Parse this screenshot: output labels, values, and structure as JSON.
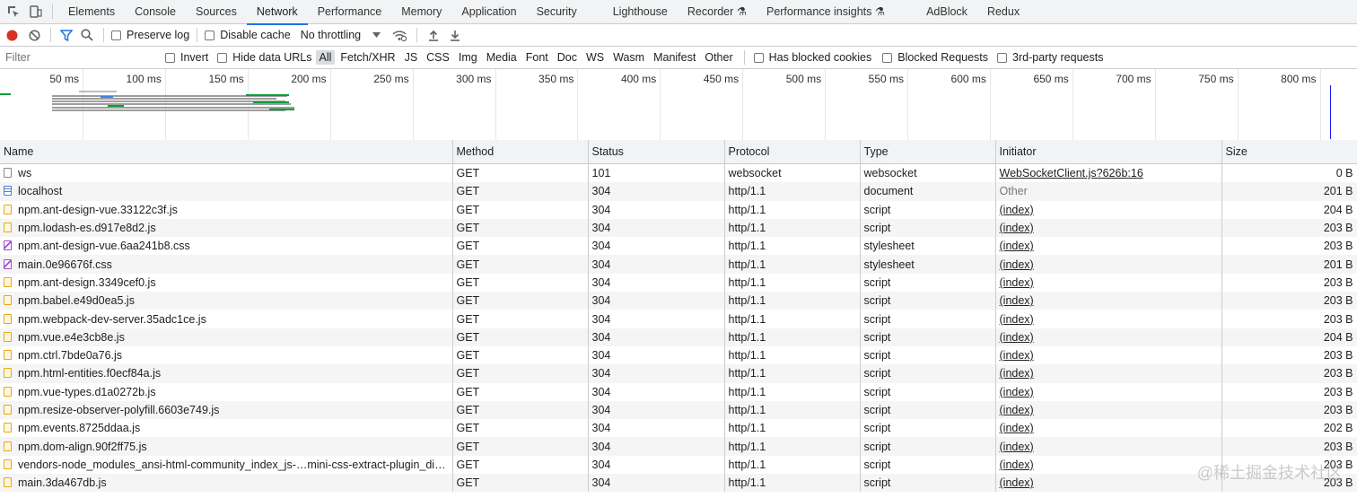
{
  "tabs": [
    "Elements",
    "Console",
    "Sources",
    "Network",
    "Performance",
    "Memory",
    "Application",
    "Security",
    "Lighthouse",
    "Recorder ⚗",
    "Performance insights ⚗",
    "AdBlock",
    "Redux"
  ],
  "toolbar": {
    "preserve_log": "Preserve log",
    "disable_cache": "Disable cache",
    "throttling": "No throttling"
  },
  "filter": {
    "placeholder": "Filter",
    "invert": "Invert",
    "hide_data_urls": "Hide data URLs",
    "types": [
      "All",
      "Fetch/XHR",
      "JS",
      "CSS",
      "Img",
      "Media",
      "Font",
      "Doc",
      "WS",
      "Wasm",
      "Manifest",
      "Other"
    ],
    "has_blocked_cookies": "Has blocked cookies",
    "blocked_requests": "Blocked Requests",
    "third_party": "3rd-party requests"
  },
  "overview": {
    "ticks": [
      "50 ms",
      "100 ms",
      "150 ms",
      "200 ms",
      "250 ms",
      "300 ms",
      "350 ms",
      "400 ms",
      "450 ms",
      "500 ms",
      "550 ms",
      "600 ms",
      "650 ms",
      "700 ms",
      "750 ms",
      "800 ms"
    ]
  },
  "columns": [
    "Name",
    "Method",
    "Status",
    "Protocol",
    "Type",
    "Initiator",
    "Size"
  ],
  "rows": [
    {
      "name": "ws",
      "method": "GET",
      "status": "101",
      "protocol": "websocket",
      "type": "websocket",
      "initiator": "WebSocketClient.js?626b:16",
      "size": "0 B",
      "icon": "ws"
    },
    {
      "name": "localhost",
      "method": "GET",
      "status": "304",
      "protocol": "http/1.1",
      "type": "document",
      "initiator": "Other",
      "size": "201 B",
      "icon": "document"
    },
    {
      "name": "npm.ant-design-vue.33122c3f.js",
      "method": "GET",
      "status": "304",
      "protocol": "http/1.1",
      "type": "script",
      "initiator": "(index)",
      "size": "204 B",
      "icon": "script"
    },
    {
      "name": "npm.lodash-es.d917e8d2.js",
      "method": "GET",
      "status": "304",
      "protocol": "http/1.1",
      "type": "script",
      "initiator": "(index)",
      "size": "203 B",
      "icon": "script"
    },
    {
      "name": "npm.ant-design-vue.6aa241b8.css",
      "method": "GET",
      "status": "304",
      "protocol": "http/1.1",
      "type": "stylesheet",
      "initiator": "(index)",
      "size": "203 B",
      "icon": "stylesheet"
    },
    {
      "name": "main.0e96676f.css",
      "method": "GET",
      "status": "304",
      "protocol": "http/1.1",
      "type": "stylesheet",
      "initiator": "(index)",
      "size": "201 B",
      "icon": "stylesheet"
    },
    {
      "name": "npm.ant-design.3349cef0.js",
      "method": "GET",
      "status": "304",
      "protocol": "http/1.1",
      "type": "script",
      "initiator": "(index)",
      "size": "203 B",
      "icon": "script"
    },
    {
      "name": "npm.babel.e49d0ea5.js",
      "method": "GET",
      "status": "304",
      "protocol": "http/1.1",
      "type": "script",
      "initiator": "(index)",
      "size": "203 B",
      "icon": "script"
    },
    {
      "name": "npm.webpack-dev-server.35adc1ce.js",
      "method": "GET",
      "status": "304",
      "protocol": "http/1.1",
      "type": "script",
      "initiator": "(index)",
      "size": "203 B",
      "icon": "script"
    },
    {
      "name": "npm.vue.e4e3cb8e.js",
      "method": "GET",
      "status": "304",
      "protocol": "http/1.1",
      "type": "script",
      "initiator": "(index)",
      "size": "204 B",
      "icon": "script"
    },
    {
      "name": "npm.ctrl.7bde0a76.js",
      "method": "GET",
      "status": "304",
      "protocol": "http/1.1",
      "type": "script",
      "initiator": "(index)",
      "size": "203 B",
      "icon": "script"
    },
    {
      "name": "npm.html-entities.f0ecf84a.js",
      "method": "GET",
      "status": "304",
      "protocol": "http/1.1",
      "type": "script",
      "initiator": "(index)",
      "size": "203 B",
      "icon": "script"
    },
    {
      "name": "npm.vue-types.d1a0272b.js",
      "method": "GET",
      "status": "304",
      "protocol": "http/1.1",
      "type": "script",
      "initiator": "(index)",
      "size": "203 B",
      "icon": "script"
    },
    {
      "name": "npm.resize-observer-polyfill.6603e749.js",
      "method": "GET",
      "status": "304",
      "protocol": "http/1.1",
      "type": "script",
      "initiator": "(index)",
      "size": "203 B",
      "icon": "script"
    },
    {
      "name": "npm.events.8725ddaa.js",
      "method": "GET",
      "status": "304",
      "protocol": "http/1.1",
      "type": "script",
      "initiator": "(index)",
      "size": "202 B",
      "icon": "script"
    },
    {
      "name": "npm.dom-align.90f2ff75.js",
      "method": "GET",
      "status": "304",
      "protocol": "http/1.1",
      "type": "script",
      "initiator": "(index)",
      "size": "203 B",
      "icon": "script"
    },
    {
      "name": "vendors-node_modules_ansi-html-community_index_js-…mini-css-extract-plugin_dist_h…",
      "method": "GET",
      "status": "304",
      "protocol": "http/1.1",
      "type": "script",
      "initiator": "(index)",
      "size": "203 B",
      "icon": "script"
    },
    {
      "name": "main.3da467db.js",
      "method": "GET",
      "status": "304",
      "protocol": "http/1.1",
      "type": "script",
      "initiator": "(index)",
      "size": "203 B",
      "icon": "script"
    }
  ],
  "watermark": "@稀土掘金技术社区"
}
